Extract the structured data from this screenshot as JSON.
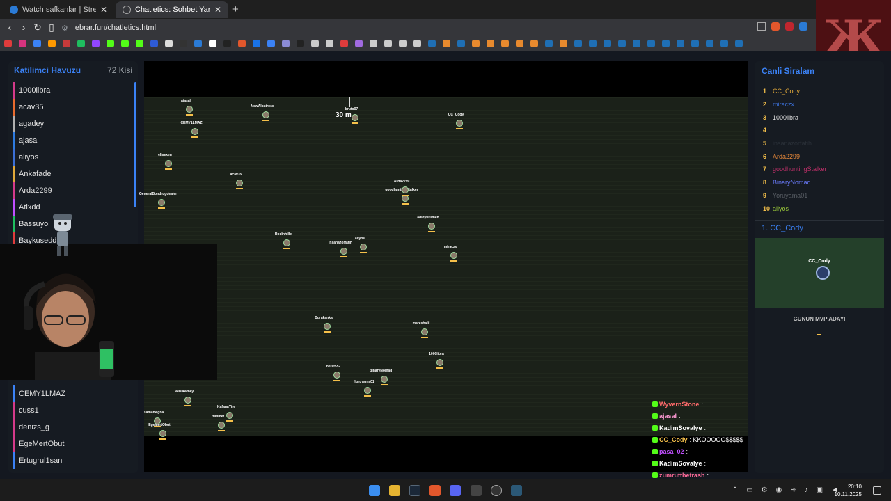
{
  "browser": {
    "tabs": [
      {
        "label": "Watch safkanlar | Streamable",
        "active": false
      },
      {
        "label": "Chatletics: Sohbet Yarislari",
        "active": true
      }
    ],
    "url": "ebrar.fun/chatletics.html"
  },
  "participants": {
    "title": "Katilimci Havuzu",
    "count": "72 Kisi",
    "items_top": [
      "1000libra",
      "acav35",
      "agadey",
      "ajasal",
      "aliyos",
      "Ankafade",
      "Arda2299",
      "Atixdd",
      "Bassuyoi",
      "Baykusedd"
    ],
    "items_bottom": [
      "CEMY1LMAZ",
      "cuss1",
      "denizs_g",
      "EgeMertObut",
      "Ertugrul1san"
    ]
  },
  "race": {
    "distance": "30 m",
    "racers": [
      {
        "name": "ajasal"
      },
      {
        "name": "CEMY1LMAZ"
      },
      {
        "name": "NewAlbatross"
      },
      {
        "name": "bruto07"
      },
      {
        "name": "CC_Cody"
      },
      {
        "name": "elisexen"
      },
      {
        "name": "acav35"
      },
      {
        "name": "goodhuntingStalker"
      },
      {
        "name": "Arda2299"
      },
      {
        "name": "GeneralBondrugdealer"
      },
      {
        "name": "adidyurumen"
      },
      {
        "name": "Rodinhille"
      },
      {
        "name": "aliyos"
      },
      {
        "name": "insanazorfatih"
      },
      {
        "name": "miraczx"
      },
      {
        "name": "Burakanka"
      },
      {
        "name": "maresbalil"
      },
      {
        "name": "1000libra"
      },
      {
        "name": "berat552"
      },
      {
        "name": "BinaryNomad"
      },
      {
        "name": "Yoruyama01"
      },
      {
        "name": "KafanaYire"
      },
      {
        "name": "Himmet"
      },
      {
        "name": "EgeMertObut"
      },
      {
        "name": "AlisAAmey"
      },
      {
        "name": "samanAgha"
      }
    ]
  },
  "chat": [
    {
      "user": "WyvernStone",
      "color": "#ff6b6b",
      "msg": ":"
    },
    {
      "user": "ajasal",
      "color": "#ff9ad5",
      "msg": ":"
    },
    {
      "user": "KadimSovalye",
      "color": "#ffffff",
      "msg": ":"
    },
    {
      "user": "CC_Cody",
      "color": "#f5c04a",
      "msg": ": KKOOOOO$$$$$"
    },
    {
      "user": "pasa_02",
      "color": "#c04fff",
      "msg": ":"
    },
    {
      "user": "KadimSovalye",
      "color": "#ffffff",
      "msg": ":"
    },
    {
      "user": "zumrutthetrash",
      "color": "#ff6b9a",
      "msg": ":"
    }
  ],
  "ranking": {
    "title": "Canli Siralam",
    "items": [
      {
        "rank": "1",
        "name": "CC_Cody",
        "color": "#e0a83a"
      },
      {
        "rank": "2",
        "name": "miraczx",
        "color": "#3b6fd6"
      },
      {
        "rank": "3",
        "name": "1000libra",
        "color": "#e0e0e0"
      },
      {
        "rank": "4",
        "name": "",
        "color": "#e0e0e0"
      },
      {
        "rank": "5",
        "name": "insanazorfatih",
        "color": "#2a3038"
      },
      {
        "rank": "6",
        "name": "Arda2299",
        "color": "#e8893a"
      },
      {
        "rank": "7",
        "name": "goodhuntingStalker",
        "color": "#c0306a"
      },
      {
        "rank": "8",
        "name": "BinaryNomad",
        "color": "#6b7cff"
      },
      {
        "rank": "9",
        "name": "Yoruyama01",
        "color": "#5a5f66"
      },
      {
        "rank": "10",
        "name": "aliyos",
        "color": "#9ac83a"
      }
    ],
    "mvp_title": "1. CC_Cody",
    "mvp_name": "CC_Cody",
    "mvp_label": "GUNUN MVP ADAYI"
  },
  "taskbar": {
    "time": "20:10",
    "date": "10.11.2025"
  },
  "colors": {
    "accent": "#3b82f6",
    "gold": "#f5c04a"
  }
}
